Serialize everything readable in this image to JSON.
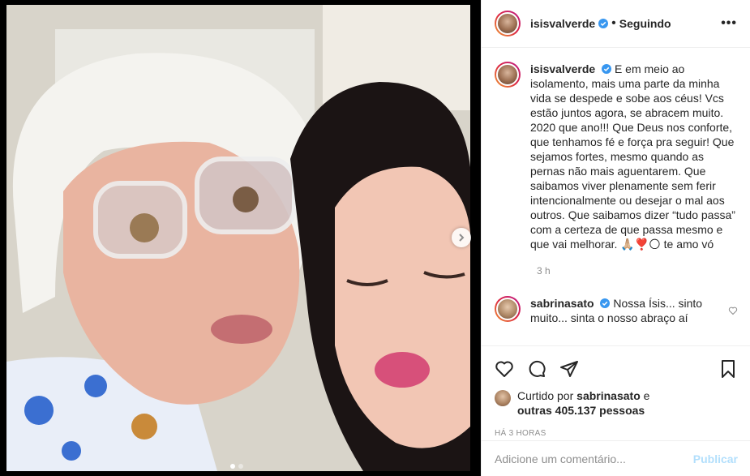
{
  "post": {
    "author": "isisvalverde",
    "follow_status": "Seguindo",
    "separator": "•",
    "more_glyph": "•••",
    "caption": "E em meio ao isolamento, mais uma parte da minha vida se despede e sobe aos céus! Vcs estão juntos agora, se abracem muito. 2020 que ano!!! Que Deus nos conforte, que tenhamos fé e força pra seguir! Que sejamos fortes, mesmo quando as pernas não mais aguentarem. Que saibamos viver plenamente sem ferir intencionalmente ou desejar o mal aos outros. Que saibamos dizer “tudo passa” com a certeza de que passa mesmo e que vai melhorar. 🙏🏼❣️🌕 te amo vó",
    "caption_time": "3 h",
    "carousel_total": 2,
    "carousel_index": 1
  },
  "comment": {
    "author": "sabrinasato",
    "text": "Nossa Ísis... sinto muito... sinta o nosso abraço aí"
  },
  "likes": {
    "prefix": "Curtido por",
    "liker": "sabrinasato",
    "connector": "e",
    "others": "outras 405.137 pessoas",
    "time_ago": "HÁ 3 HORAS"
  },
  "add_comment": {
    "placeholder": "Adicione um comentário...",
    "publish_label": "Publicar"
  },
  "colors": {
    "verified": "#3897f0",
    "publish_disabled": "#b2dffc",
    "muted": "#8e8e8e"
  },
  "icons": [
    "verified-icon",
    "more-options-icon",
    "next-arrow-icon",
    "heart-icon",
    "comment-icon",
    "share-icon",
    "bookmark-icon",
    "like-comment-icon"
  ]
}
